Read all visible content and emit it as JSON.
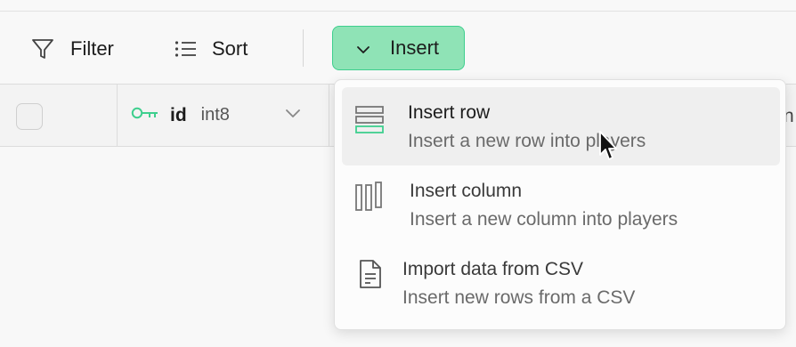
{
  "toolbar": {
    "filter": {
      "label": "Filter",
      "icon": "filter-icon"
    },
    "sort": {
      "label": "Sort",
      "icon": "sort-list-icon"
    },
    "insert": {
      "label": "Insert",
      "icon": "chevron-down-icon"
    }
  },
  "grid": {
    "columns": [
      {
        "name": "id",
        "type": "int8",
        "icon": "primary-key-icon"
      }
    ],
    "edge_text": "n"
  },
  "insert_menu": {
    "items": [
      {
        "title": "Insert row",
        "description": "Insert a new row into players",
        "icon": "insert-row-icon",
        "highlighted": true
      },
      {
        "title": "Insert column",
        "description": "Insert a new column into players",
        "icon": "insert-column-icon"
      },
      {
        "title": "Import data from CSV",
        "description": "Insert new rows from a CSV",
        "icon": "file-text-icon"
      }
    ]
  },
  "colors": {
    "accent_fill": "#8fe3b6",
    "accent_border": "#3ecf8e",
    "key_icon": "#3ecf8e",
    "highlight": "#efefef"
  }
}
